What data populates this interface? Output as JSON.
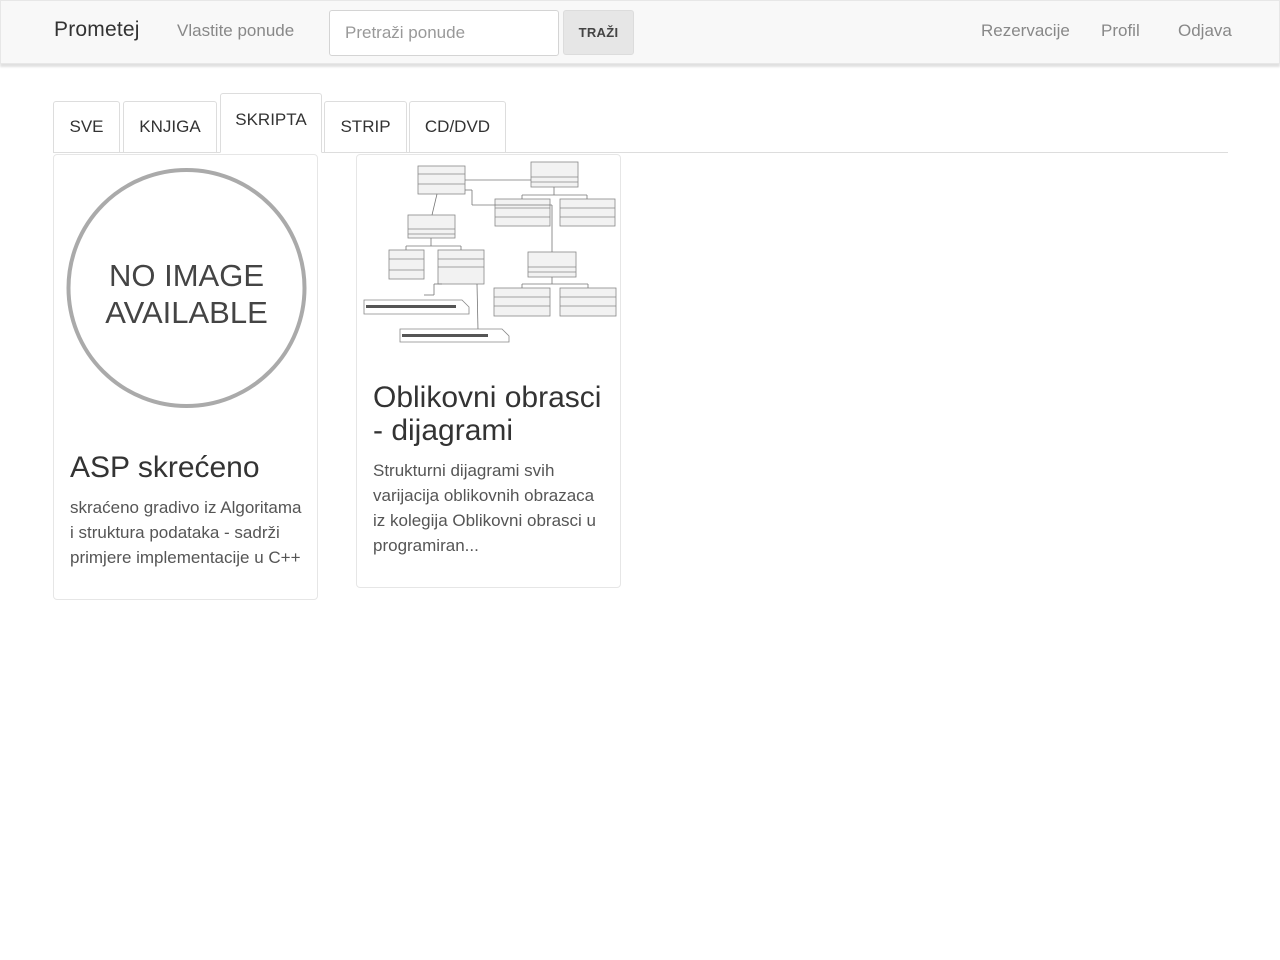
{
  "navbar": {
    "brand": "Prometej",
    "own_offers": "Vlastite ponude",
    "search_placeholder": "Pretraži ponude",
    "search_button": "TRAŽI",
    "reservations": "Rezervacije",
    "profile": "Profil",
    "logout": "Odjava"
  },
  "tabs": [
    {
      "label": "SVE",
      "active": false
    },
    {
      "label": "KNJIGA",
      "active": false
    },
    {
      "label": "SKRIPTA",
      "active": true
    },
    {
      "label": "STRIP",
      "active": false
    },
    {
      "label": "CD/DVD",
      "active": false
    }
  ],
  "cards": [
    {
      "image": "no-image-placeholder",
      "image_text": [
        "NO IMAGE",
        "AVAILABLE"
      ],
      "title": "ASP skrećeno",
      "description": [
        "skraćeno gradivo iz Algoritama",
        "i struktura podataka - sadrži",
        "primjere implementacije u C++"
      ]
    },
    {
      "image": "uml-diagram-thumbnail",
      "title": [
        "Oblikovni obrasci",
        "- dijagrami"
      ],
      "description": [
        "Strukturni dijagrami svih",
        "varijacija oblikovnih obrazaca",
        "iz kolegija Oblikovni obrasci u",
        "programiran..."
      ]
    }
  ]
}
